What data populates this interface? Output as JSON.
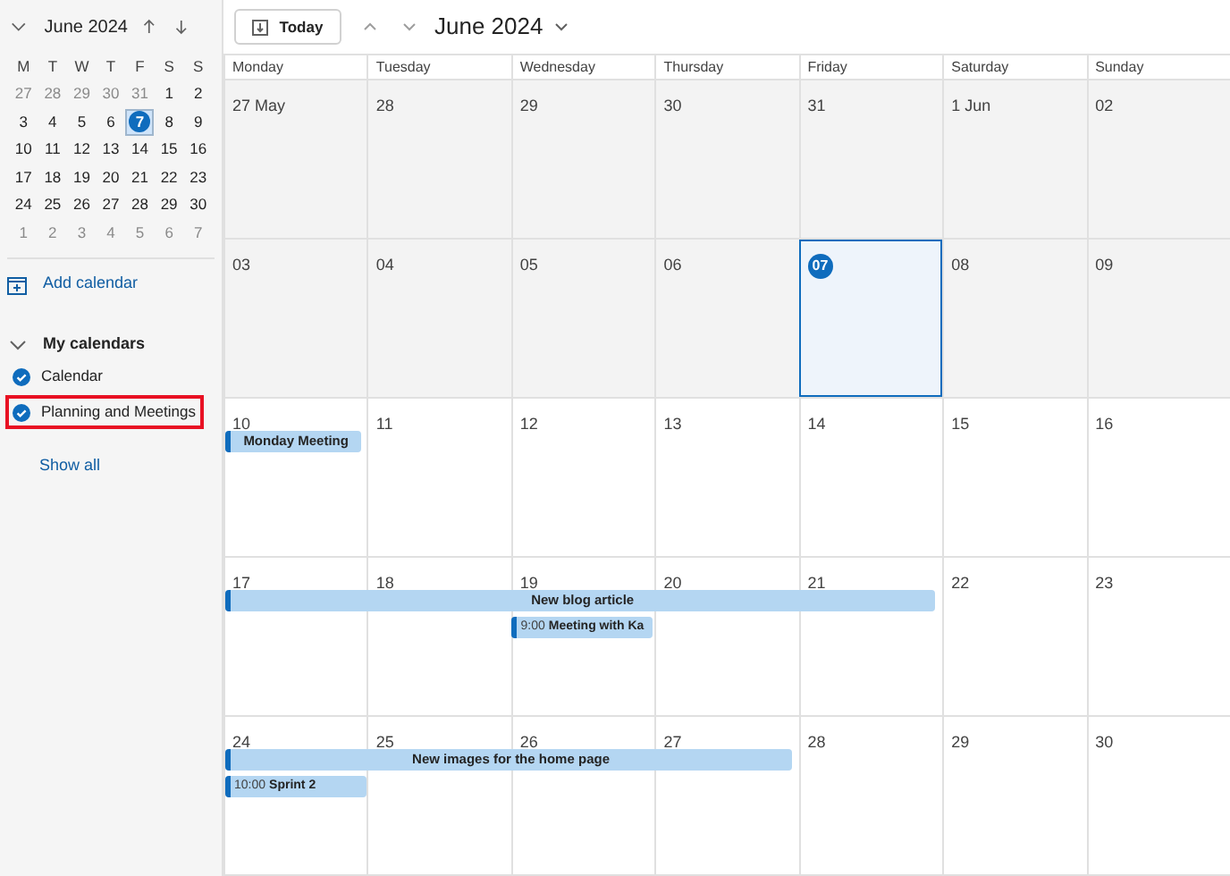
{
  "mini_calendar": {
    "title": "June 2024",
    "weekdays": [
      "M",
      "T",
      "W",
      "T",
      "F",
      "S",
      "S"
    ],
    "weeks": [
      [
        {
          "label": "27",
          "outside": true,
          "today": false
        },
        {
          "label": "28",
          "outside": true,
          "today": false
        },
        {
          "label": "29",
          "outside": true,
          "today": false
        },
        {
          "label": "30",
          "outside": true,
          "today": false
        },
        {
          "label": "31",
          "outside": true,
          "today": false
        },
        {
          "label": "1",
          "outside": false,
          "today": false
        },
        {
          "label": "2",
          "outside": false,
          "today": false
        }
      ],
      [
        {
          "label": "3",
          "outside": false,
          "today": false
        },
        {
          "label": "4",
          "outside": false,
          "today": false
        },
        {
          "label": "5",
          "outside": false,
          "today": false
        },
        {
          "label": "6",
          "outside": false,
          "today": false
        },
        {
          "label": "7",
          "outside": false,
          "today": true
        },
        {
          "label": "8",
          "outside": false,
          "today": false
        },
        {
          "label": "9",
          "outside": false,
          "today": false
        }
      ],
      [
        {
          "label": "10",
          "outside": false,
          "today": false
        },
        {
          "label": "11",
          "outside": false,
          "today": false
        },
        {
          "label": "12",
          "outside": false,
          "today": false
        },
        {
          "label": "13",
          "outside": false,
          "today": false
        },
        {
          "label": "14",
          "outside": false,
          "today": false
        },
        {
          "label": "15",
          "outside": false,
          "today": false
        },
        {
          "label": "16",
          "outside": false,
          "today": false
        }
      ],
      [
        {
          "label": "17",
          "outside": false,
          "today": false
        },
        {
          "label": "18",
          "outside": false,
          "today": false
        },
        {
          "label": "19",
          "outside": false,
          "today": false
        },
        {
          "label": "20",
          "outside": false,
          "today": false
        },
        {
          "label": "21",
          "outside": false,
          "today": false
        },
        {
          "label": "22",
          "outside": false,
          "today": false
        },
        {
          "label": "23",
          "outside": false,
          "today": false
        }
      ],
      [
        {
          "label": "24",
          "outside": false,
          "today": false
        },
        {
          "label": "25",
          "outside": false,
          "today": false
        },
        {
          "label": "26",
          "outside": false,
          "today": false
        },
        {
          "label": "27",
          "outside": false,
          "today": false
        },
        {
          "label": "28",
          "outside": false,
          "today": false
        },
        {
          "label": "29",
          "outside": false,
          "today": false
        },
        {
          "label": "30",
          "outside": false,
          "today": false
        }
      ],
      [
        {
          "label": "1",
          "outside": true,
          "today": false
        },
        {
          "label": "2",
          "outside": true,
          "today": false
        },
        {
          "label": "3",
          "outside": true,
          "today": false
        },
        {
          "label": "4",
          "outside": true,
          "today": false
        },
        {
          "label": "5",
          "outside": true,
          "today": false
        },
        {
          "label": "6",
          "outside": true,
          "today": false
        },
        {
          "label": "7",
          "outside": true,
          "today": false
        }
      ]
    ]
  },
  "add_calendar": "Add calendar",
  "my_calendars": {
    "title": "My calendars",
    "expanded": true,
    "items": [
      {
        "label": "Calendar",
        "checked": true,
        "highlighted": false
      },
      {
        "label": "Planning and Meetings",
        "checked": true,
        "highlighted": true
      }
    ]
  },
  "show_all": "Show all",
  "toolbar": {
    "today_button": "Today",
    "title": "June 2024"
  },
  "month": {
    "weekdays": [
      "Monday",
      "Tuesday",
      "Wednesday",
      "Thursday",
      "Friday",
      "Saturday",
      "Sunday"
    ],
    "weeks": [
      {
        "shaded": true,
        "days": [
          {
            "label": "27 May",
            "today": false,
            "selected": false
          },
          {
            "label": "28",
            "today": false,
            "selected": false
          },
          {
            "label": "29",
            "today": false,
            "selected": false
          },
          {
            "label": "30",
            "today": false,
            "selected": false
          },
          {
            "label": "31",
            "today": false,
            "selected": false
          },
          {
            "label": "1 Jun",
            "today": false,
            "selected": false
          },
          {
            "label": "02",
            "today": false,
            "selected": false
          }
        ]
      },
      {
        "shaded": true,
        "days": [
          {
            "label": "03",
            "today": false,
            "selected": false
          },
          {
            "label": "04",
            "today": false,
            "selected": false
          },
          {
            "label": "05",
            "today": false,
            "selected": false
          },
          {
            "label": "06",
            "today": false,
            "selected": false
          },
          {
            "label": "07",
            "today": true,
            "selected": true
          },
          {
            "label": "08",
            "today": false,
            "selected": false
          },
          {
            "label": "09",
            "today": false,
            "selected": false
          }
        ]
      },
      {
        "shaded": false,
        "days": [
          {
            "label": "10",
            "today": false,
            "selected": false,
            "events": [
              {
                "kind": "all_day",
                "title": "Monday Meeting"
              }
            ]
          },
          {
            "label": "11",
            "today": false,
            "selected": false
          },
          {
            "label": "12",
            "today": false,
            "selected": false
          },
          {
            "label": "13",
            "today": false,
            "selected": false
          },
          {
            "label": "14",
            "today": false,
            "selected": false
          },
          {
            "label": "15",
            "today": false,
            "selected": false
          },
          {
            "label": "16",
            "today": false,
            "selected": false
          }
        ]
      },
      {
        "shaded": false,
        "days": [
          {
            "label": "17",
            "today": false,
            "selected": false,
            "events": [
              {
                "kind": "all_day",
                "title": "New blog article"
              }
            ]
          },
          {
            "label": "18",
            "today": false,
            "selected": false,
            "events": [
              {
                "kind": "continuation"
              }
            ]
          },
          {
            "label": "19",
            "today": false,
            "selected": false,
            "events": [
              {
                "kind": "continuation"
              },
              {
                "kind": "timed",
                "time": "9:00",
                "title": "Meeting with Ka"
              }
            ]
          },
          {
            "label": "20",
            "today": false,
            "selected": false,
            "events": [
              {
                "kind": "continuation"
              }
            ]
          },
          {
            "label": "21",
            "today": false,
            "selected": false,
            "events": [
              {
                "kind": "continuation"
              }
            ]
          },
          {
            "label": "22",
            "today": false,
            "selected": false
          },
          {
            "label": "23",
            "today": false,
            "selected": false
          }
        ]
      },
      {
        "shaded": false,
        "days": [
          {
            "label": "24",
            "today": false,
            "selected": false,
            "events": [
              {
                "kind": "all_day",
                "title": "New images for the home page"
              },
              {
                "kind": "timed",
                "time": "10:00",
                "title": "Sprint 2"
              }
            ]
          },
          {
            "label": "25",
            "today": false,
            "selected": false,
            "events": [
              {
                "kind": "continuation"
              }
            ]
          },
          {
            "label": "26",
            "today": false,
            "selected": false,
            "events": [
              {
                "kind": "continuation"
              }
            ]
          },
          {
            "label": "27",
            "today": false,
            "selected": false,
            "events": [
              {
                "kind": "continuation"
              }
            ]
          },
          {
            "label": "28",
            "today": false,
            "selected": false
          },
          {
            "label": "29",
            "today": false,
            "selected": false
          },
          {
            "label": "30",
            "today": false,
            "selected": false
          }
        ]
      }
    ]
  }
}
